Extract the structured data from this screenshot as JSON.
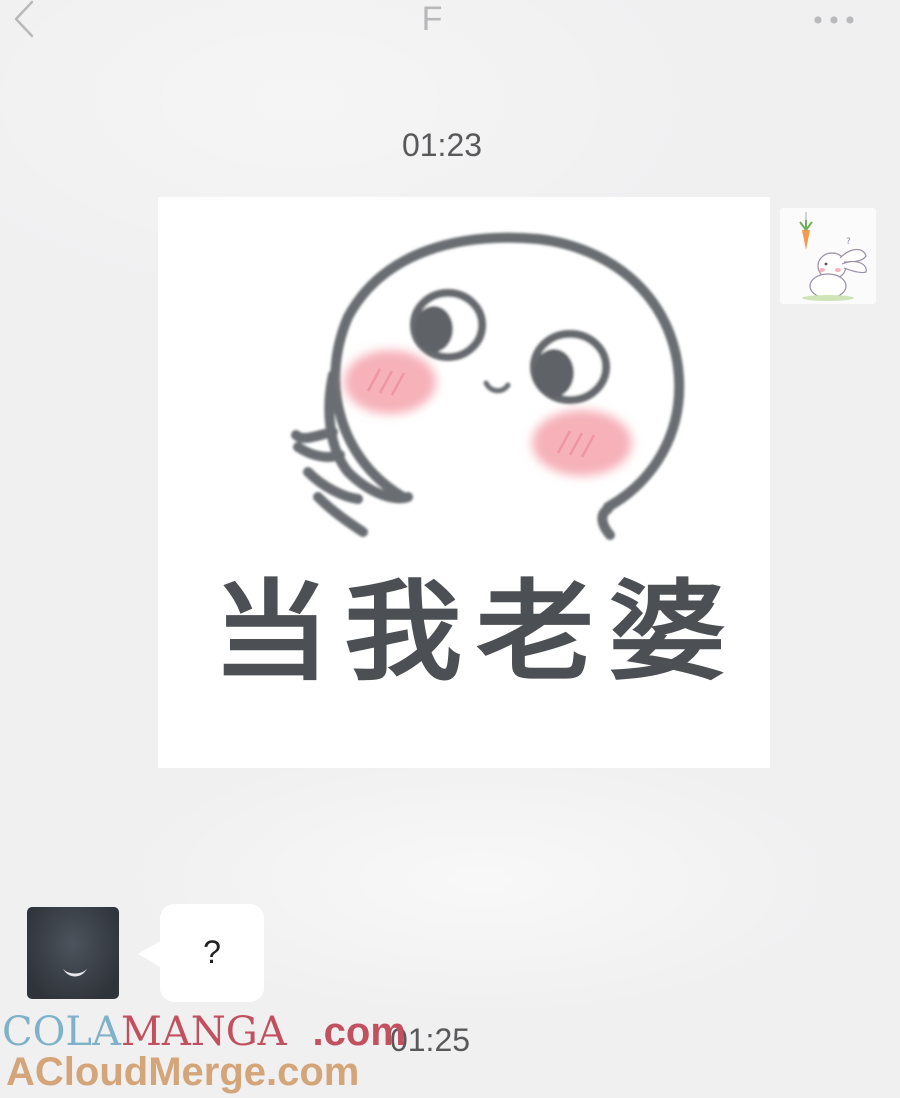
{
  "header": {
    "title": "F",
    "back_icon": "chevron-left-icon",
    "more_icon": "more-dots-icon"
  },
  "messages": [
    {
      "timestamp": "01:23",
      "sender": "me",
      "type": "sticker",
      "sticker_text": "当我老婆"
    },
    {
      "sender": "other",
      "type": "text",
      "text": "?"
    },
    {
      "timestamp": "01:25"
    }
  ],
  "watermark": {
    "line1_part1": "COLA",
    "line1_part2": "MANGA",
    "line1_part3": ".com",
    "line2": "ACloudMerge.com"
  },
  "colors": {
    "background": "#f0f0f1",
    "bubble": "#ffffff",
    "timestamp": "#59595c",
    "blush": "#f4a6b0"
  }
}
